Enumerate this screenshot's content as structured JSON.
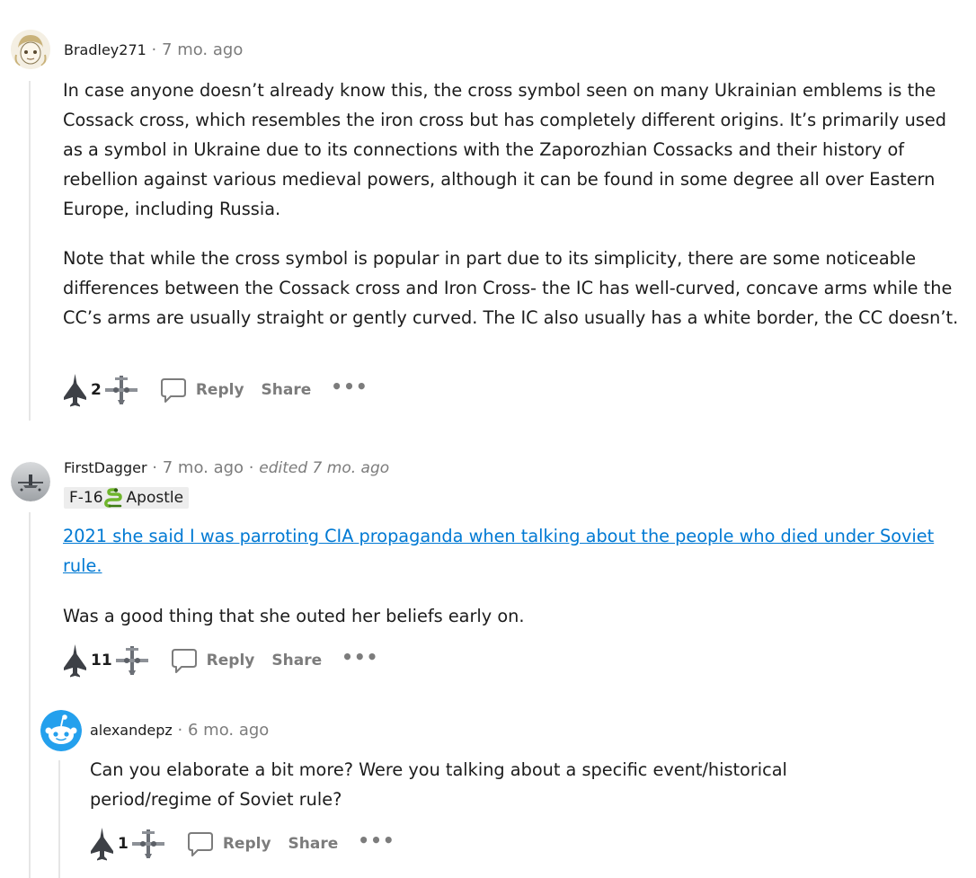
{
  "comments": [
    {
      "author": "Bradley271",
      "time": "7 mo. ago",
      "paragraphs": [
        "In case anyone doesn’t already know this, the cross symbol seen on many Ukrainian emblems is the Cossack cross, which resembles the iron cross but has completely different origins. It’s primarily used as a symbol in Ukraine due to its connections with the Zaporozhian Cossacks and their history of rebellion against various medieval powers, although it can be found in some degree all over Eastern Europe, including Russia.",
        "Note that while the cross symbol is popular in part due to its simplicity, there are some noticeable differences between the Cossack cross and Iron Cross- the IC has well-curved, concave arms while the CC’s arms are usually straight or gently curved. The IC also usually has a white border, the CC doesn’t."
      ],
      "votes": "2",
      "reply_label": "Reply",
      "share_label": "Share",
      "more_label": "•••"
    },
    {
      "author": "FirstDagger",
      "time": "7 mo. ago",
      "edited": "edited 7 mo. ago",
      "flair_prefix": "F-16",
      "flair_text": "Apostle",
      "link_text": "2021 she said I was parroting CIA propaganda when talking about the people who died under Soviet rule.",
      "paragraph": "Was a good thing that she outed her beliefs early on.",
      "votes": "11",
      "reply_label": "Reply",
      "share_label": "Share",
      "more_label": "•••"
    },
    {
      "author": "alexandepz",
      "time": "6 mo. ago",
      "paragraph": "Can you elaborate a bit more? Were you talking about a specific event/historical period/regime of Soviet rule?",
      "votes": "1",
      "reply_label": "Reply",
      "share_label": "Share",
      "more_label": "•••"
    }
  ],
  "separator": "·",
  "icons": {
    "upvote": "fighter-jet-upvote-icon",
    "downvote": "attack-plane-downvote-icon",
    "reply": "speech-bubble-icon",
    "flair_emoji": "snake-icon"
  },
  "colors": {
    "link": "#0079d3",
    "meta": "#7c7c7c",
    "action": "#7c7c7c",
    "thread_line": "#e6e6e6",
    "flair_bg": "#ededed"
  }
}
